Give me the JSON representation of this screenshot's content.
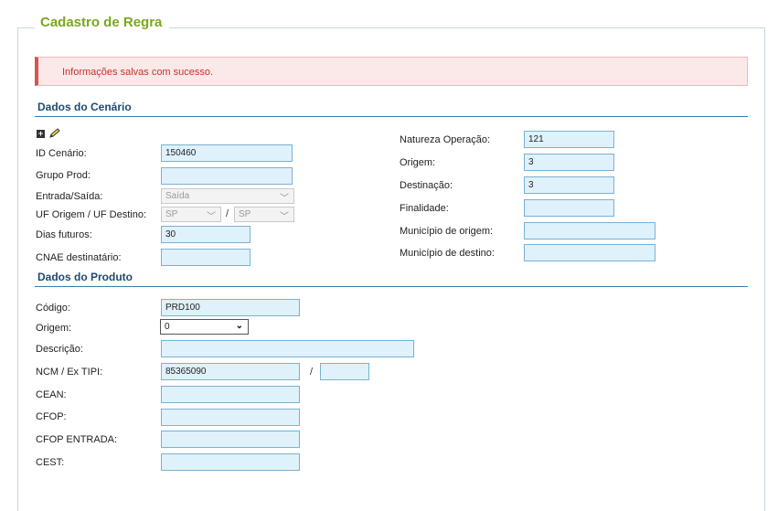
{
  "page": {
    "title": "Cadastro de Regra"
  },
  "alert": {
    "message": "Informações salvas com sucesso."
  },
  "scenario": {
    "title": "Dados do Cenário",
    "id_label": "ID Cenário:",
    "id_value": "150460",
    "grupo_label": "Grupo Prod:",
    "grupo_value": "",
    "entrada_label": "Entrada/Saída:",
    "entrada_value": "Saída",
    "uf_label": "UF Origem / UF Destino:",
    "uf_origem": "SP",
    "uf_destino": "SP",
    "uf_sep": "/",
    "dias_label": "Dias futuros:",
    "dias_value": "30",
    "cnae_label": "CNAE destinatário:",
    "cnae_value": "",
    "natureza_label": "Natureza Operação:",
    "natureza_value": "121",
    "origem_label": "Origem:",
    "origem_value": "3",
    "destinacao_label": "Destinação:",
    "destinacao_value": "3",
    "finalidade_label": "Finalidade:",
    "finalidade_value": "",
    "mun_origem_label": "Município de origem:",
    "mun_origem_value": "",
    "mun_destino_label": "Município de destino:",
    "mun_destino_value": ""
  },
  "product": {
    "title": "Dados do Produto",
    "codigo_label": "Código:",
    "codigo_value": "PRD100",
    "origem_label": "Origem:",
    "origem_value": "0",
    "descricao_label": "Descrição:",
    "descricao_value": "",
    "ncm_label": "NCM / Ex TIPI:",
    "ncm_value": "85365090",
    "ncm_sep": "/",
    "ex_tipi_value": "",
    "cean_label": "CEAN:",
    "cean_value": "",
    "cfop_label": "CFOP:",
    "cfop_value": "",
    "cfop_entrada_label": "CFOP ENTRADA:",
    "cfop_entrada_value": "",
    "cest_label": "CEST:",
    "cest_value": ""
  },
  "icons": {
    "expand": "plus-box-icon",
    "edit": "pencil-icon"
  }
}
